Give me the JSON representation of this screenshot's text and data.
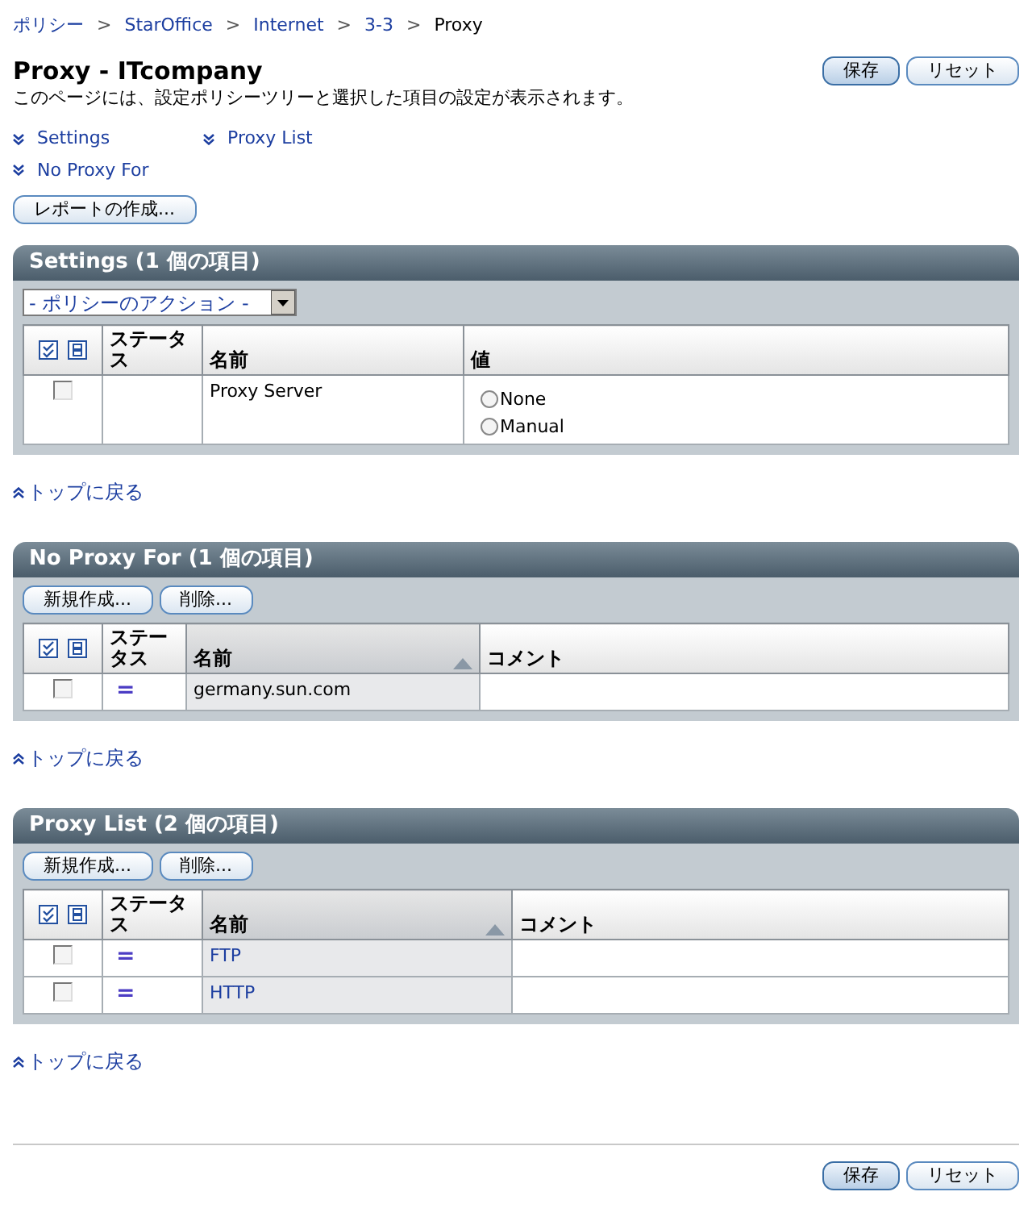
{
  "breadcrumb": [
    {
      "label": "ポリシー",
      "link": true
    },
    {
      "label": "StarOffice",
      "link": true
    },
    {
      "label": "Internet",
      "link": true
    },
    {
      "label": "3-3",
      "link": true
    },
    {
      "label": "Proxy",
      "link": false
    }
  ],
  "separator": ">",
  "title": "Proxy - ITcompany",
  "description": "このページには、設定ポリシーツリーと選択した項目の設定が表示されます。",
  "top_buttons": [
    {
      "label": "保存",
      "primary": true
    },
    {
      "label": "リセット",
      "primary": false
    }
  ],
  "jump_links": [
    {
      "label": "Settings"
    },
    {
      "label": "Proxy List"
    },
    {
      "label": "No Proxy For"
    }
  ],
  "report_button": "レポートの作成...",
  "sections": [
    {
      "title": "Settings (1 個の項目)",
      "toolbar": {
        "kind": "select",
        "value": "- ポリシーのアクション -"
      },
      "columns": [
        {
          "label": "ステータス",
          "sorted": false
        },
        {
          "label": "名前",
          "sorted": false
        },
        {
          "label": "値",
          "sorted": false
        }
      ],
      "rows": [
        {
          "checked": false,
          "name": "Proxy Server",
          "link": false,
          "value": {
            "kind": "radio",
            "options": [
              {
                "label": "None",
                "selected": false
              },
              {
                "label": "Manual",
                "selected": false
              }
            ]
          }
        }
      ],
      "back_to_top": "トップに戻る"
    },
    {
      "title": "No Proxy For (1 個の項目)",
      "toolbar": {
        "kind": "buttons",
        "buttons": [
          "新規作成...",
          "削除..."
        ]
      },
      "columns": [
        {
          "label": "ステータス",
          "sorted": false
        },
        {
          "label": "名前",
          "sorted": true
        },
        {
          "label": "コメント",
          "sorted": false
        }
      ],
      "rows": [
        {
          "checked": false,
          "status": "=",
          "name": "germany.sun.com",
          "link": false
        }
      ],
      "back_to_top": "トップに戻る"
    },
    {
      "title": "Proxy List (2 個の項目)",
      "toolbar": {
        "kind": "buttons",
        "buttons": [
          "新規作成...",
          "削除..."
        ]
      },
      "columns": [
        {
          "label": "ステータス",
          "sorted": false
        },
        {
          "label": "名前",
          "sorted": true
        },
        {
          "label": "コメント",
          "sorted": false
        }
      ],
      "rows": [
        {
          "checked": false,
          "status": "=",
          "name": "FTP",
          "link": true
        },
        {
          "checked": false,
          "status": "=",
          "name": "HTTP",
          "link": true
        }
      ],
      "back_to_top": "トップに戻る"
    }
  ],
  "bottom_buttons": [
    {
      "label": "保存",
      "primary": true
    },
    {
      "label": "リセット",
      "primary": false
    }
  ]
}
